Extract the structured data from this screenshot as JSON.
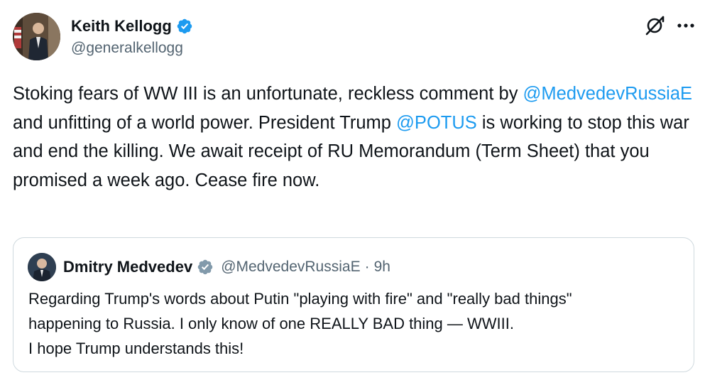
{
  "author": {
    "name": "Keith Kellogg",
    "handle": "@generalkellogg"
  },
  "tweet": {
    "segments": [
      {
        "text": "Stoking fears of WW III is an unfortunate, reckless comment by ",
        "type": "text"
      },
      {
        "text": "@MedvedevRussiaE",
        "type": "mention"
      },
      {
        "text": " and unfitting of a world power. President Trump ",
        "type": "text"
      },
      {
        "text": "@POTUS",
        "type": "mention"
      },
      {
        "text": " is working to stop this war and end the killing. We await receipt of RU Memorandum (Term Sheet) that you promised a week ago. Cease fire now.",
        "type": "text"
      }
    ]
  },
  "quoted": {
    "name": "Dmitry Medvedev",
    "handle": "@MedvedevRussiaE",
    "separator": "·",
    "time": "9h",
    "lines": [
      "Regarding Trump's words about Putin \"playing with fire\" and \"really bad things\"",
      "happening to Russia. I only know of one REALLY BAD thing — WWIII.",
      "I hope Trump understands this!"
    ]
  },
  "icons": {
    "verified_main": "verified-badge-icon",
    "verified_quoted": "gov-verified-badge-icon",
    "grok": "grok-icon",
    "more": "more-icon"
  },
  "colors": {
    "link": "#1d9bf0",
    "verified_blue": "#1d9bf0",
    "verified_gray": "#829aab",
    "secondary_text": "#536471",
    "border": "#cfd9de"
  }
}
